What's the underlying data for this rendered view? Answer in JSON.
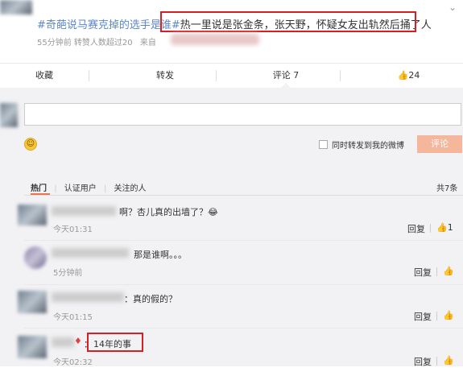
{
  "post": {
    "topic": "#奇葩说马赛克掉的选手是谁#",
    "text": "热一里说是张金条，张天野，怀疑女友出轨然后捅了人",
    "meta": "55分钟前 转赞人数超过20",
    "source_prefix": "来自"
  },
  "actions": {
    "favorite": "收藏",
    "repost": "转发",
    "comment": "评论 7",
    "like": "24"
  },
  "compose": {
    "also_repost": "同时转发到我的微博",
    "submit": "评论"
  },
  "filters": {
    "hot": "热门",
    "verified": "认证用户",
    "following": "关注的人",
    "total": "共7条"
  },
  "comments": [
    {
      "text": "啊？杏儿真的出墙了？😂",
      "time": "今天01:31",
      "reply": "回复",
      "likes": "1"
    },
    {
      "text": "那是谁啊。。。",
      "time": "5分钟前",
      "reply": "回复",
      "likes": ""
    },
    {
      "text": "：真的假的？",
      "time": "今天01:15",
      "reply": "回复",
      "likes": ""
    },
    {
      "text": "14年的事",
      "colon": "：",
      "time": "今天02:32",
      "reply": "回复",
      "likes": ""
    }
  ],
  "colors": {
    "accent": "#eb7350",
    "link": "#5b87c7",
    "highlight": "#d81e25"
  }
}
